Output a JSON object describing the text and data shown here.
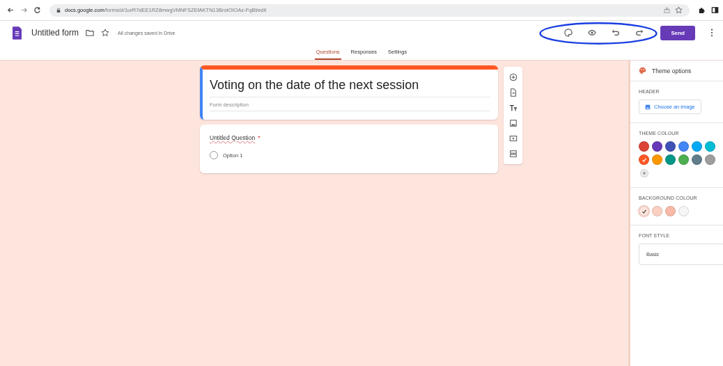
{
  "browser": {
    "url_host": "docs.google.com",
    "url_path": "/forms/d/1urR7dEE1RZ8mwgVMNFSZEfAKTN13BrotOIOAz-FqBl/edit"
  },
  "header": {
    "title": "Untitled form",
    "save_status": "All changes saved in Drive",
    "send_label": "Send"
  },
  "tabs": [
    {
      "label": "Questions",
      "selected": true
    },
    {
      "label": "Responses",
      "selected": false
    },
    {
      "label": "Settings",
      "selected": false
    }
  ],
  "form": {
    "title": "Voting on the date of the next session",
    "description_placeholder": "Form description"
  },
  "question": {
    "title": "Untitled Question",
    "required": true,
    "required_mark": "*",
    "options": [
      {
        "label": "Option 1",
        "selected": false
      }
    ]
  },
  "theme_panel": {
    "title": "Theme options",
    "header_label": "HEADER",
    "choose_image": "Choose an image",
    "theme_colour_label": "THEME COLOUR",
    "theme_colours": [
      {
        "color": "#db4437",
        "selected": false
      },
      {
        "color": "#673ab7",
        "selected": false
      },
      {
        "color": "#3f51b5",
        "selected": false
      },
      {
        "color": "#4285f4",
        "selected": false
      },
      {
        "color": "#03a9f4",
        "selected": false
      },
      {
        "color": "#00bcd4",
        "selected": false
      },
      {
        "color": "#ff5722",
        "selected": true
      },
      {
        "color": "#ff9800",
        "selected": false
      },
      {
        "color": "#009688",
        "selected": false
      },
      {
        "color": "#4caf50",
        "selected": false
      },
      {
        "color": "#607d8b",
        "selected": false
      },
      {
        "color": "#9e9e9e",
        "selected": false
      }
    ],
    "background_colour_label": "BACKGROUND COLOUR",
    "background_colours": [
      {
        "color": "#fde4dc",
        "selected": true
      },
      {
        "color": "#fbd0c2",
        "selected": false
      },
      {
        "color": "#f9bba7",
        "selected": false
      },
      {
        "color": "#f6f6f6",
        "selected": false
      }
    ],
    "font_style_label": "FONT STYLE",
    "font_style": "Basic"
  }
}
